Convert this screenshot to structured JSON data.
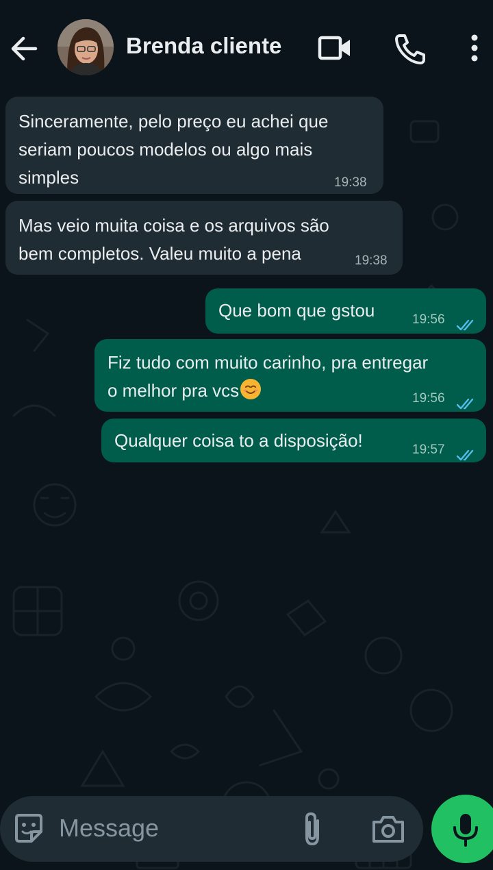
{
  "header": {
    "contact_name": "Brenda cliente",
    "icons": [
      "back-arrow-icon",
      "video-call-icon",
      "voice-call-icon",
      "more-options-icon"
    ]
  },
  "messages": [
    {
      "direction": "incoming",
      "lines": [
        "Sinceramente, pelo preço eu achei que",
        "seriam poucos modelos ou algo mais",
        "simples"
      ],
      "time": "19:38"
    },
    {
      "direction": "incoming",
      "lines": [
        "Mas veio muita coisa e os arquivos são",
        "bem completos. Valeu muito a pena"
      ],
      "time": "19:38"
    },
    {
      "direction": "outgoing",
      "lines": [
        "Que bom que gstou"
      ],
      "time": "19:56",
      "status": "read"
    },
    {
      "direction": "outgoing",
      "lines": [
        "Fiz tudo com muito carinho, pra entregar",
        "o melhor pra vcs"
      ],
      "emoji": "smiling-face-emoji",
      "time": "19:56",
      "status": "read"
    },
    {
      "direction": "outgoing",
      "lines": [
        "Qualquer coisa to a disposição!"
      ],
      "time": "19:57",
      "status": "read"
    }
  ],
  "composer": {
    "placeholder": "Message",
    "icons": [
      "sticker-icon",
      "attach-icon",
      "camera-icon",
      "microphone-icon"
    ]
  },
  "colors": {
    "background": "#0b141a",
    "incoming_bubble": "#202c33",
    "outgoing_bubble": "#005c4b",
    "mic_button": "#21c063",
    "read_ticks": "#53bdeb"
  }
}
